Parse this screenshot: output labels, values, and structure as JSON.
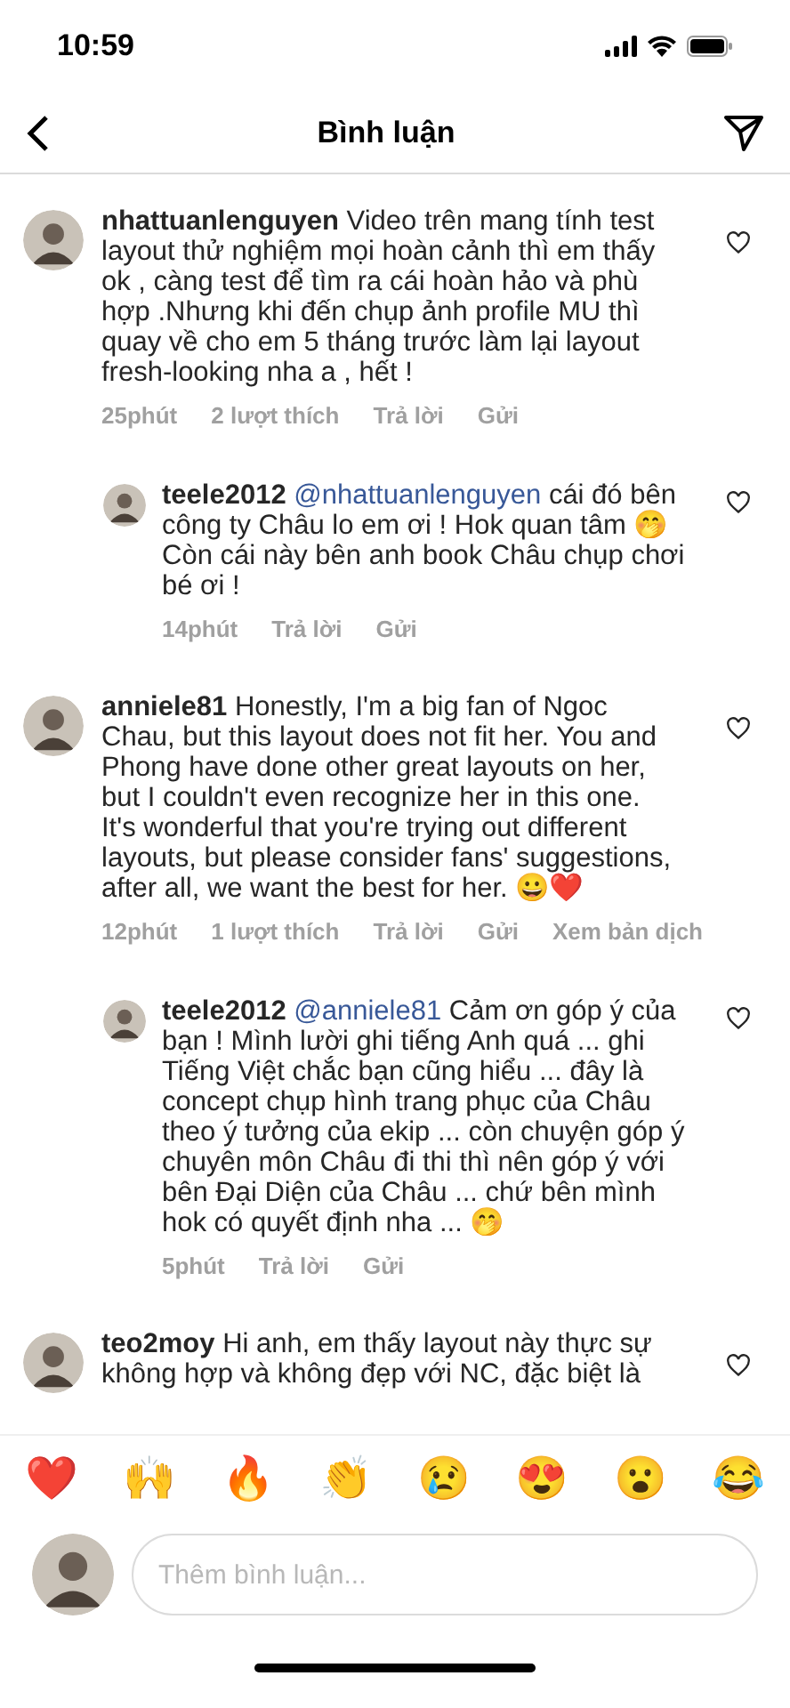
{
  "status_bar": {
    "time": "10:59"
  },
  "header": {
    "title": "Bình luận"
  },
  "comments": [
    {
      "kind": "comment",
      "username": "nhattuanlenguyen",
      "text": "Video trên mang tính test layout thử nghiệm mọi hoàn cảnh thì em thấy ok , càng test để tìm ra cái hoàn hảo và phù hợp .Nhưng khi đến chụp ảnh  profile MU thì quay về cho em 5 tháng trước làm lại layout fresh-looking nha a , hết !",
      "actions": [
        "25phút",
        "2 lượt thích",
        "Trả lời",
        "Gửi"
      ]
    },
    {
      "kind": "reply",
      "username": "teele2012",
      "mention": "@nhattuanlenguyen",
      "text": "cái đó bên công ty Châu lo em ơi ! Hok quan tâm 🤭 Còn cái này bên anh book Châu chụp chơi bé ơi !",
      "actions": [
        "14phút",
        "Trả lời",
        "Gửi"
      ]
    },
    {
      "kind": "comment",
      "username": "anniele81",
      "text": "Honestly, I'm a big fan of Ngoc Chau, but this layout does not fit her.  You and Phong have done other great layouts on her, but I couldn't even recognize her in this one. It's wonderful that you're trying out different layouts, but please consider fans' suggestions, after all, we want the best for her. 😀❤️",
      "actions": [
        "12phút",
        "1 lượt thích",
        "Trả lời",
        "Gửi",
        "Xem bản dịch"
      ]
    },
    {
      "kind": "reply",
      "username": "teele2012",
      "mention": "@anniele81",
      "text": "Cảm ơn góp ý của bạn ! Mình lười ghi tiếng Anh quá ... ghi Tiếng Việt chắc bạn cũng hiểu ... đây là concept chụp hình trang phục của Châu theo ý tưởng của ekip ... còn chuyện góp ý chuyên môn Châu đi thi thì nên góp ý với bên Đại Diện của Châu ... chứ bên mình hok có quyết định nha ... 🤭",
      "actions": [
        "5phút",
        "Trả lời",
        "Gửi"
      ]
    },
    {
      "kind": "comment",
      "username": "teo2moy",
      "text": "Hi anh, em thấy layout này thực sự không hợp và không đẹp với NC, đặc biệt là"
    }
  ],
  "reactions": [
    "❤️",
    "🙌",
    "🔥",
    "👏",
    "😢",
    "😍",
    "😮",
    "😂"
  ],
  "composer": {
    "placeholder": "Thêm bình luận..."
  }
}
